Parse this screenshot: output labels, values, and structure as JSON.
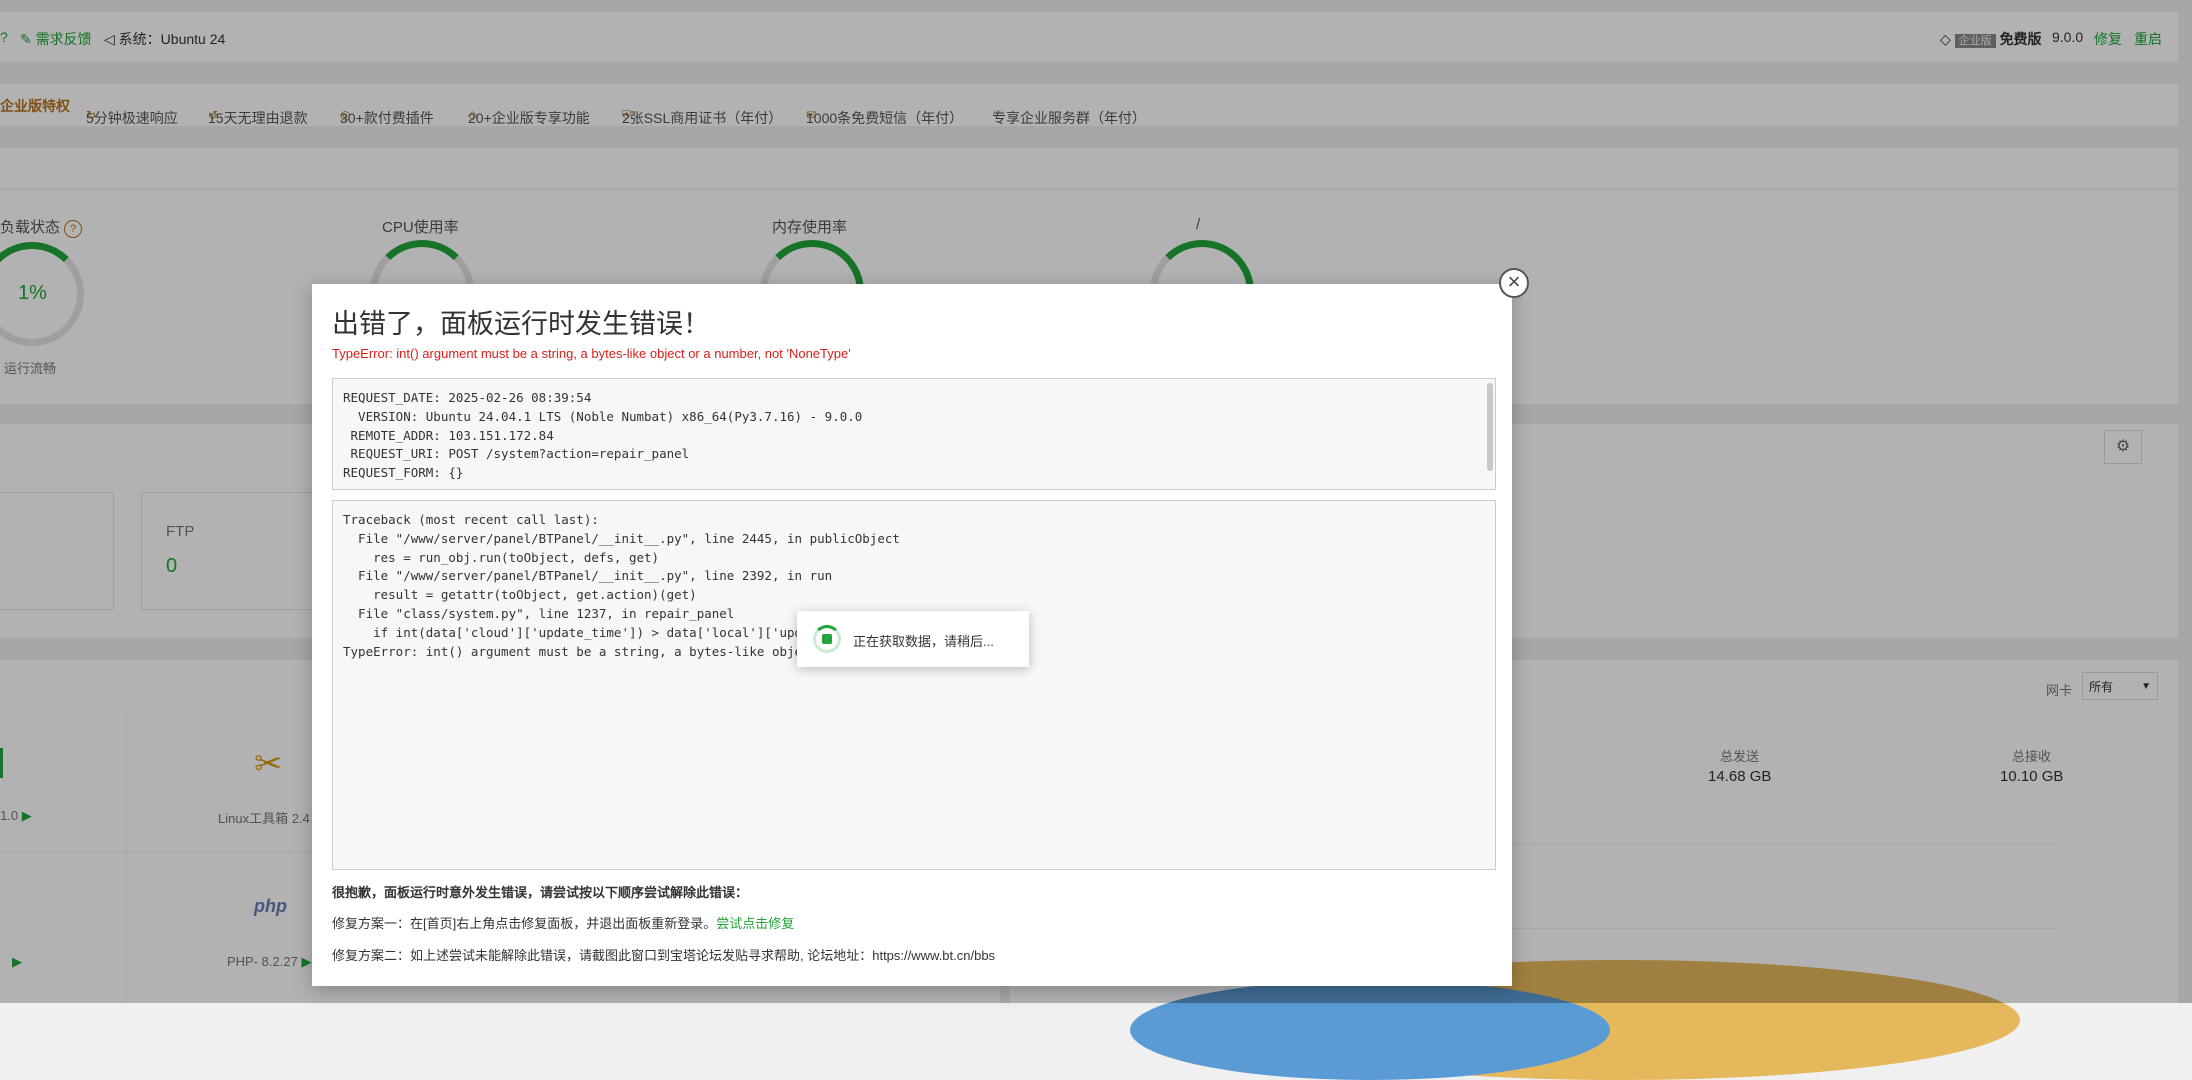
{
  "topbar": {
    "feedback": "需求反馈",
    "system": "系统：Ubuntu 24",
    "edition_badge": "企业版",
    "free": "免费版",
    "version": "9.0.0",
    "repair": "修复",
    "restart": "重启"
  },
  "adbar": {
    "enterprise": "企业版特权",
    "items": [
      "5分钟极速响应",
      "15天无理由退款",
      "30+款付费插件",
      "20+企业版专享功能",
      "2张SSL商用证书（年付）",
      "1000条免费短信（年付）",
      "专享企业服务群（年付）"
    ]
  },
  "status": {
    "load_title": "负载状态",
    "load_value": "1%",
    "load_sub": "运行流畅",
    "cpu_title": "CPU使用率",
    "mem_title": "内存使用率",
    "disk_title": "/"
  },
  "overview": {
    "ftp_label": "FTP",
    "ftp_value": "0"
  },
  "apps": {
    "item1_version": "1.0",
    "linux_tools": "Linux工具箱 2.4",
    "php_logo": "php",
    "php_version": "PHP- 8.2.27"
  },
  "traffic": {
    "nic_label": "网卡",
    "nic_select": "所有",
    "sent_label": "总发送",
    "sent_value": "14.68 GB",
    "recv_label": "总接收",
    "recv_value": "10.10 GB"
  },
  "modal": {
    "title": "出错了，面板运行时发生错误！",
    "error": "TypeError: int() argument must be a string, a bytes-like object or a number, not 'NoneType'",
    "request_info": "REQUEST_DATE: 2025-02-26 08:39:54\n  VERSION: Ubuntu 24.04.1 LTS (Noble Numbat) x86_64(Py3.7.16) - 9.0.0\n REMOTE_ADDR: 103.151.172.84\n REQUEST_URI: POST /system?action=repair_panel\nREQUEST_FORM: {}",
    "traceback": "Traceback (most recent call last):\n  File \"/www/server/panel/BTPanel/__init__.py\", line 2445, in publicObject\n    res = run_obj.run(toObject, defs, get)\n  File \"/www/server/panel/BTPanel/__init__.py\", line 2392, in run\n    result = getattr(toObject, get.action)(get)\n  File \"class/system.py\", line 1237, in repair_panel\n    if int(data['cloud']['update_time']) > data['local']['update\nTypeError: int() argument must be a string, a bytes-like object",
    "sorry": "很抱歉，面板运行时意外发生错误，请尝试按以下顺序尝试解除此错误：",
    "fix1": "修复方案一：在[首页]右上角点击修复面板，并退出面板重新登录。",
    "fix1_link": "尝试点击修复",
    "fix2": "修复方案二：如上述尝试未能解除此错误，请截图此窗口到宝塔论坛发贴寻求帮助, 论坛地址：https://www.bt.cn/bbs",
    "close": "×"
  },
  "loading": {
    "text": "正在获取数据，请稍后..."
  },
  "colors": {
    "accent": "#20a53a",
    "error": "#d9201c",
    "enterprise": "#b8741a"
  }
}
